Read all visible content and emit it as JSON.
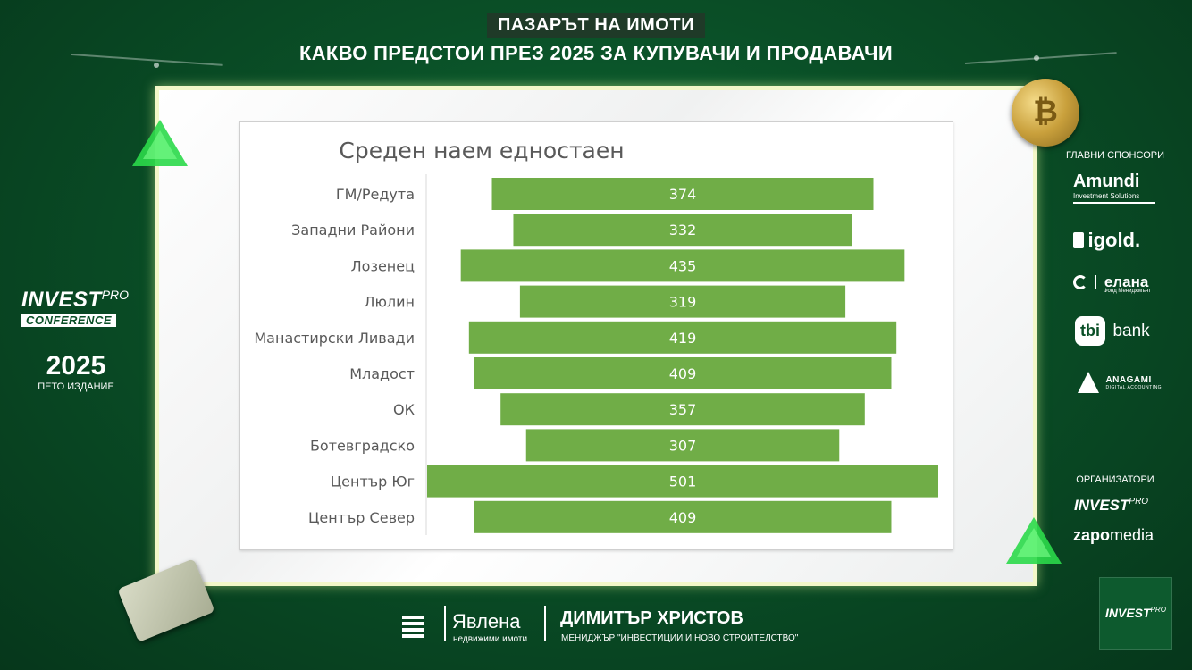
{
  "header": {
    "kicker": "ПАЗАРЪТ НА ИМОТИ",
    "title": "КАКВО ПРЕДСТОИ ПРЕЗ 2025 ЗА КУПУВАЧИ И ПРОДАВАЧИ"
  },
  "chart_data": {
    "type": "bar",
    "title": "Среден наем едностаен",
    "orientation": "horizontal-centered",
    "categories": [
      "ГМ/Редута",
      "Западни Райони",
      "Лозенец",
      "Люлин",
      "Манастирски Ливади",
      "Младост",
      "ОК",
      "Ботевградско",
      "Център Юг",
      "Център Север"
    ],
    "values": [
      374,
      332,
      435,
      319,
      419,
      409,
      357,
      307,
      501,
      409
    ],
    "xlim": [
      0,
      501
    ],
    "bar_color": "#70ad47",
    "label_color": "#ffffff",
    "grid": false,
    "legend": "none"
  },
  "left_brand": {
    "invest": "INVEST",
    "pro": "PRO",
    "conference": "CONFERENCE",
    "year": "2025",
    "edition": "ПЕТО ИЗДАНИЕ"
  },
  "sponsors": {
    "heading": "ГЛАВНИ СПОНСОРИ",
    "amundi": "Amundi",
    "amundi_sub": "Investment Solutions",
    "igold": "igold.",
    "elana": "елана",
    "elana_sub": "Фонд Мениджмънт",
    "tbi": "tbi",
    "tbi_bank": "bank",
    "anagami": "ANAGAMI",
    "anagami_sub": "DIGITAL ACCOUNTING"
  },
  "organizers": {
    "heading": "ОРГАНИЗАТОРИ",
    "invest": "INVEST",
    "pro": "PRO",
    "zapo": "zapo",
    "media": "media"
  },
  "footer": {
    "brand": "Явлена",
    "brand_sub": "недвижими имоти",
    "speaker_name": "ДИМИТЪР ХРИСТОВ",
    "speaker_role": "МЕНИДЖЪР \"ИНВЕСТИЦИИ И НОВО СТРОИТЕЛСТВО\""
  },
  "corner_badge": {
    "invest": "INVEST",
    "pro": "PRO"
  },
  "colors": {
    "background": "#0a4f27",
    "frame_border": "#f3f7c8",
    "bar": "#70ad47",
    "accent_green": "#39ff5a"
  }
}
